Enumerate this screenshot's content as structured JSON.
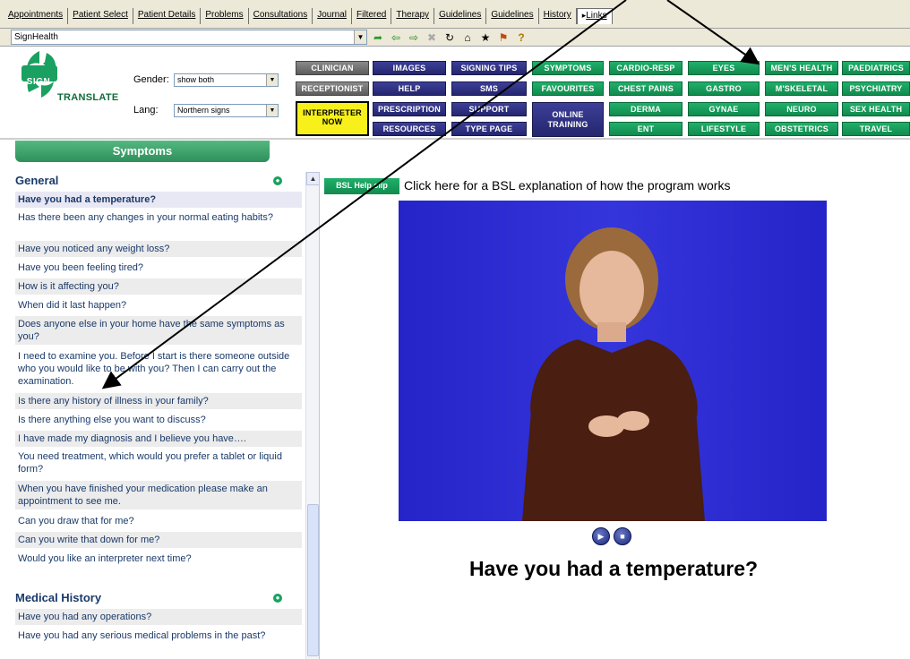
{
  "tabs": [
    "Appointments",
    "Patient Select",
    "Patient Details",
    "Problems",
    "Consultations",
    "Journal",
    "Filtered",
    "Therapy",
    "Guidelines",
    "Guidelines",
    "History",
    "Links"
  ],
  "active_tab": "Links",
  "address": {
    "value": "SignHealth"
  },
  "nav_icons": [
    "arrow-go-icon",
    "back-icon",
    "forward-icon",
    "stop-icon",
    "refresh-icon",
    "home-icon",
    "favorites-icon",
    "tools-icon",
    "help-icon"
  ],
  "logo": {
    "sign": "SIGN",
    "translate": "TRANSLATE"
  },
  "filters": {
    "gender_label": "Gender:",
    "gender_value": "show both",
    "lang_label": "Lang:",
    "lang_value": "Northern signs"
  },
  "buttons": {
    "clinician": "CLINICIAN",
    "receptionist": "RECEPTIONIST",
    "interpreter_1": "INTERPRETER",
    "interpreter_2": "NOW",
    "images": "IMAGES",
    "help": "HELP",
    "prescription": "PRESCRIPTION",
    "resources": "RESOURCES",
    "signing_tips": "SIGNING TIPS",
    "sms": "SMS",
    "support": "SUPPORT",
    "type_page": "TYPE PAGE",
    "symptoms": "SYMPTOMS",
    "favourites": "FAVOURITES",
    "online_1": "ONLINE",
    "online_2": "TRAINING",
    "cardio": "CARDIO-RESP",
    "chest": "CHEST PAINS",
    "derma": "DERMA",
    "ent": "ENT",
    "eyes": "EYES",
    "gastro": "GASTRO",
    "gynae": "GYNAE",
    "lifestyle": "LIFESTYLE",
    "mens": "MEN'S HEALTH",
    "mskeletal": "M'SKELETAL",
    "neuro": "NEURO",
    "obstetrics": "OBSTETRICS",
    "paediatrics": "PAEDIATRICS",
    "psychiatry": "PSYCHIATRY",
    "sexhealth": "SEX HEALTH",
    "travel": "TRAVEL"
  },
  "symptoms_header": "Symptoms",
  "sections": {
    "general": {
      "title": "General",
      "items": [
        "Have you had a temperature?",
        "Has there been any changes in your normal eating habits?",
        "Have you noticed any weight loss?",
        "Have you been feeling tired?",
        "How is it affecting you?",
        "When did it last happen?",
        "Does anyone else in your home have the same symptoms as you?",
        "I need to examine you. Before I start is there someone outside who you would like to be with you? Then I can carry out the examination.",
        "Is there any history of illness in your family?",
        "Is there anything else you want to discuss?",
        "I have made my diagnosis and I believe you have….",
        "You need treatment, which would you prefer a tablet or liquid form?",
        "When you have finished your medication please make an appointment to see me.",
        "Can you draw that for me?",
        "Can you write that down for me?",
        "Would you like an interpreter next time?"
      ]
    },
    "medical_history": {
      "title": "Medical History",
      "items": [
        "Have you had any operations?",
        "Have you had any serious medical problems in the past?"
      ]
    }
  },
  "bsl": {
    "button": "BSL Help clip",
    "text": "Click here for a BSL explanation of how the program works"
  },
  "video": {
    "caption": "Have you had a temperature?"
  },
  "colors": {
    "accent_green": "#1fb06a",
    "navy": "#2a2c7c",
    "grey": "#6e6e6e",
    "interpreter_yellow": "#f7f01a",
    "video_blue": "#2b2bd2"
  }
}
